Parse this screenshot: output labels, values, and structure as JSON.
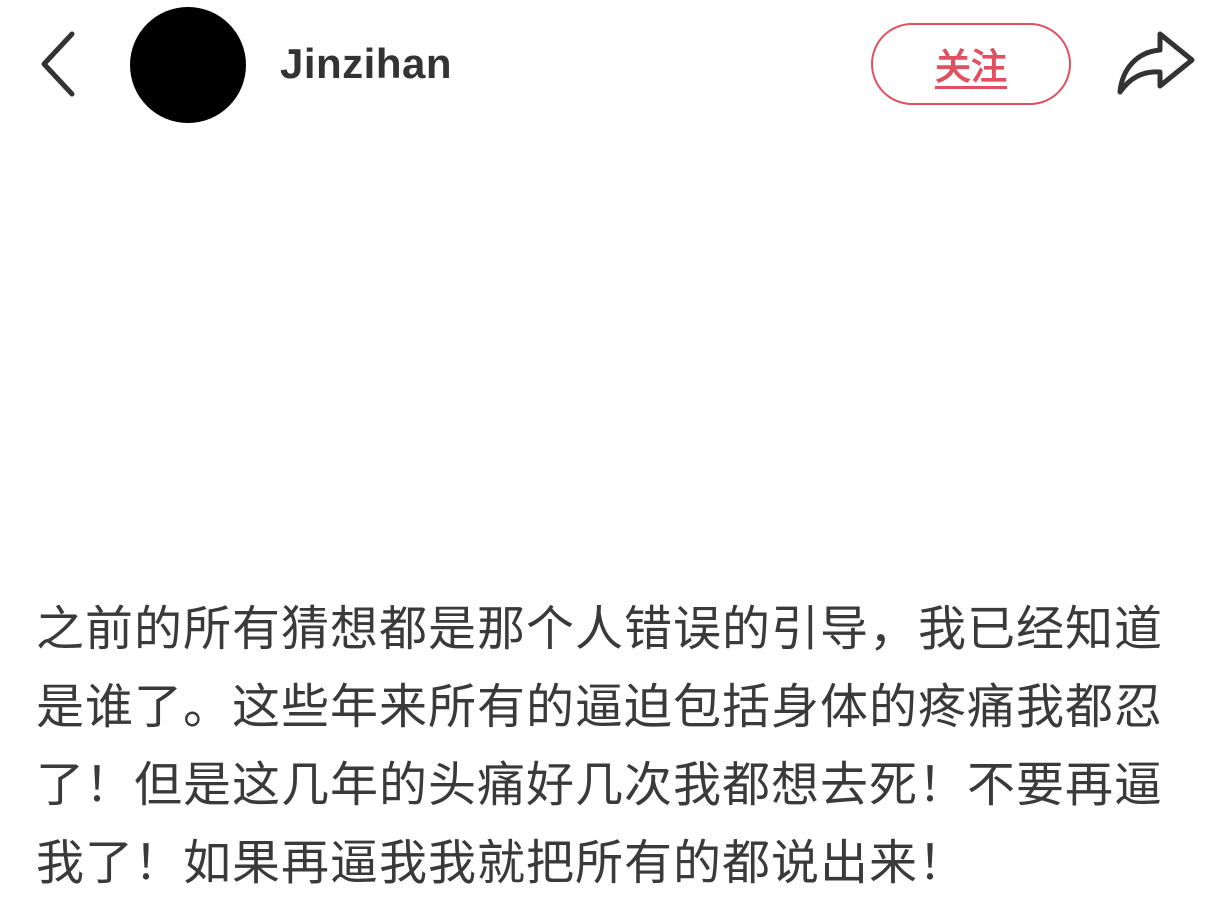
{
  "header": {
    "back_icon": "chevron-left-icon",
    "username": "Jinzihan",
    "follow_label": "关注",
    "share_icon": "share-arrow-icon"
  },
  "post": {
    "text": "之前的所有猜想都是那个人错误的引导，我已经知道是谁了。这些年来所有的逼迫包括身体的疼痛我都忍了！但是这几年的头痛好几次我都想去死！不要再逼我了！如果再逼我我就把所有的都说出来！"
  },
  "colors": {
    "accent": "#e0505f",
    "text": "#333333",
    "avatar": "#000000",
    "background": "#ffffff"
  }
}
